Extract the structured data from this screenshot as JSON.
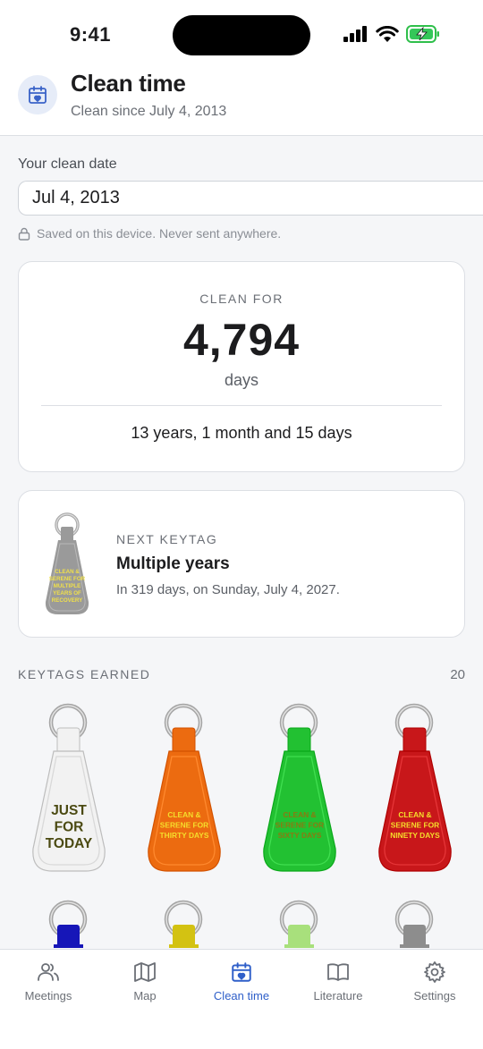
{
  "status_bar": {
    "time": "9:41"
  },
  "header": {
    "title": "Clean time",
    "subtitle": "Clean since July 4, 2013",
    "icon": "calendar-heart-icon"
  },
  "date": {
    "label": "Your clean date",
    "value": "Jul 4, 2013",
    "saved_note": "Saved on this device. Never sent anywhere."
  },
  "clean": {
    "label": "CLEAN FOR",
    "days": "4,794",
    "unit": "days",
    "detail": "13 years, 1 month and 15 days"
  },
  "next_keytag": {
    "label": "NEXT KEYTAG",
    "title": "Multiple years",
    "description": "In 319 days, on Sunday, July 4, 2027.",
    "tag_text": [
      "CLEAN &",
      "SERENE FOR",
      "MULTIPLE",
      "YEARS OF",
      "RECOVERY"
    ],
    "color": "#9a9a9a"
  },
  "earned": {
    "label": "KEYTAGS EARNED",
    "count": "20",
    "tags": [
      {
        "lines": [
          "JUST",
          "FOR",
          "TODAY"
        ],
        "color": "#f2f2f2",
        "text_color": "#4b4a12",
        "large": true
      },
      {
        "lines": [
          "CLEAN &",
          "SERENE FOR",
          "THIRTY DAYS"
        ],
        "color": "#ec6b10",
        "text_color": "#f5de2b",
        "large": false
      },
      {
        "lines": [
          "CLEAN &",
          "SERENE FOR",
          "SIXTY DAYS"
        ],
        "color": "#22c132",
        "text_color": "#8a7a12",
        "large": false
      },
      {
        "lines": [
          "CLEAN &",
          "SERENE FOR",
          "NINETY DAYS"
        ],
        "color": "#c8171a",
        "text_color": "#f5de2b",
        "large": false
      }
    ],
    "partial_tag_colors": [
      "#1616b8",
      "#d3c212",
      "#a8e07c",
      "#8d8d8d"
    ]
  },
  "tabs": [
    {
      "label": "Meetings",
      "icon": "people-icon",
      "active": false
    },
    {
      "label": "Map",
      "icon": "map-icon",
      "active": false
    },
    {
      "label": "Clean time",
      "icon": "calendar-heart-icon",
      "active": true
    },
    {
      "label": "Literature",
      "icon": "book-icon",
      "active": false
    },
    {
      "label": "Settings",
      "icon": "gear-icon",
      "active": false
    }
  ]
}
